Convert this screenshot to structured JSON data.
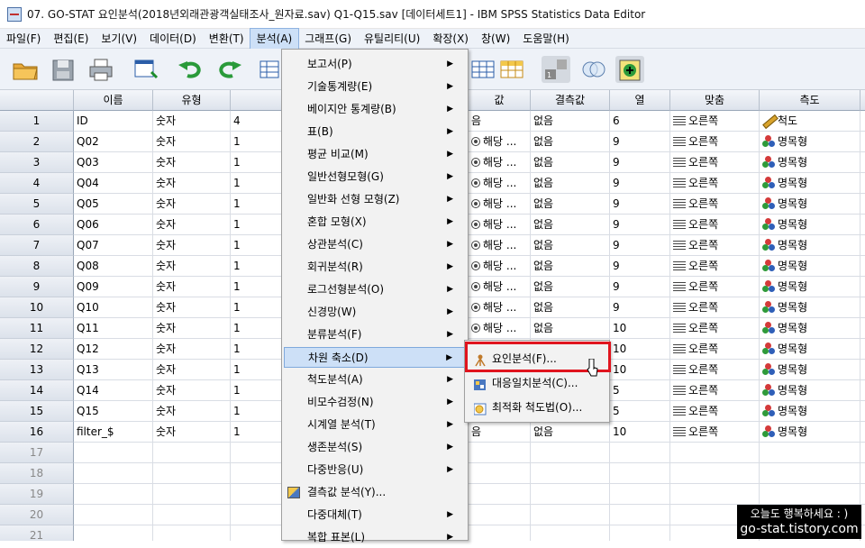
{
  "window": {
    "title": "07. GO-STAT 요인분석(2018년외래관광객실태조사_원자료.sav) Q1-Q15.sav [데이터세트1] - IBM SPSS Statistics Data Editor"
  },
  "menubar": [
    "파일(F)",
    "편집(E)",
    "보기(V)",
    "데이터(D)",
    "변환(T)",
    "분석(A)",
    "그래프(G)",
    "유틸리티(U)",
    "확장(X)",
    "창(W)",
    "도움말(H)"
  ],
  "grid": {
    "headers": [
      "이름",
      "유형",
      "너비",
      "값",
      "결측값",
      "열",
      "맞춤",
      "측도"
    ],
    "rows": [
      {
        "n": "1",
        "name": "ID",
        "type": "숫자",
        "width": "4",
        "value": "음",
        "missing": "없음",
        "col": "6",
        "align": "오른쪽",
        "measure": "척도"
      },
      {
        "n": "2",
        "name": "Q02",
        "type": "숫자",
        "width": "1",
        "value": "해당 ...",
        "missing": "없음",
        "col": "9",
        "align": "오른쪽",
        "measure": "명목형"
      },
      {
        "n": "3",
        "name": "Q03",
        "type": "숫자",
        "width": "1",
        "value": "해당 ...",
        "missing": "없음",
        "col": "9",
        "align": "오른쪽",
        "measure": "명목형"
      },
      {
        "n": "4",
        "name": "Q04",
        "type": "숫자",
        "width": "1",
        "value": "해당 ...",
        "missing": "없음",
        "col": "9",
        "align": "오른쪽",
        "measure": "명목형"
      },
      {
        "n": "5",
        "name": "Q05",
        "type": "숫자",
        "width": "1",
        "value": "해당 ...",
        "missing": "없음",
        "col": "9",
        "align": "오른쪽",
        "measure": "명목형"
      },
      {
        "n": "6",
        "name": "Q06",
        "type": "숫자",
        "width": "1",
        "value": "해당 ...",
        "missing": "없음",
        "col": "9",
        "align": "오른쪽",
        "measure": "명목형"
      },
      {
        "n": "7",
        "name": "Q07",
        "type": "숫자",
        "width": "1",
        "value": "해당 ...",
        "missing": "없음",
        "col": "9",
        "align": "오른쪽",
        "measure": "명목형"
      },
      {
        "n": "8",
        "name": "Q08",
        "type": "숫자",
        "width": "1",
        "value": "해당 ...",
        "missing": "없음",
        "col": "9",
        "align": "오른쪽",
        "measure": "명목형"
      },
      {
        "n": "9",
        "name": "Q09",
        "type": "숫자",
        "width": "1",
        "value": "해당 ...",
        "missing": "없음",
        "col": "9",
        "align": "오른쪽",
        "measure": "명목형"
      },
      {
        "n": "10",
        "name": "Q10",
        "type": "숫자",
        "width": "1",
        "value": "해당 ...",
        "missing": "없음",
        "col": "9",
        "align": "오른쪽",
        "measure": "명목형"
      },
      {
        "n": "11",
        "name": "Q11",
        "type": "숫자",
        "width": "1",
        "value": "해당 ...",
        "missing": "없음",
        "col": "10",
        "align": "오른쪽",
        "measure": "명목형"
      },
      {
        "n": "12",
        "name": "Q12",
        "type": "숫자",
        "width": "1",
        "value": "",
        "missing": "",
        "col": "10",
        "align": "오른쪽",
        "measure": "명목형"
      },
      {
        "n": "13",
        "name": "Q13",
        "type": "숫자",
        "width": "1",
        "value": "",
        "missing": "",
        "col": "10",
        "align": "오른쪽",
        "measure": "명목형"
      },
      {
        "n": "14",
        "name": "Q14",
        "type": "숫자",
        "width": "1",
        "value": "",
        "missing": "",
        "col": "5",
        "align": "오른쪽",
        "measure": "명목형"
      },
      {
        "n": "15",
        "name": "Q15",
        "type": "숫자",
        "width": "1",
        "value": "",
        "missing": "",
        "col": "5",
        "align": "오른쪽",
        "measure": "명목형"
      },
      {
        "n": "16",
        "name": "filter_$",
        "type": "숫자",
        "width": "1",
        "value": "음",
        "missing": "없음",
        "col": "10",
        "align": "오른쪽",
        "measure": "명목형"
      },
      {
        "n": "17"
      },
      {
        "n": "18"
      },
      {
        "n": "19"
      },
      {
        "n": "20"
      },
      {
        "n": "21"
      }
    ]
  },
  "analyze_menu": [
    "보고서(P)",
    "기술통계량(E)",
    "베이지안 통계량(B)",
    "표(B)",
    "평균 비교(M)",
    "일반선형모형(G)",
    "일반화 선형 모형(Z)",
    "혼합 모형(X)",
    "상관분석(C)",
    "회귀분석(R)",
    "로그선형분석(O)",
    "신경망(W)",
    "분류분석(F)",
    "차원 축소(D)",
    "척도분석(A)",
    "비모수검정(N)",
    "시계열 분석(T)",
    "생존분석(S)",
    "다중반응(U)",
    "결측값 분석(Y)...",
    "다중대체(T)",
    "복합 표본(L)"
  ],
  "submenu": [
    "요인분석(F)...",
    "대응일치분석(C)...",
    "최적화 척도법(O)..."
  ],
  "watermark": {
    "line1": "오늘도 행복하세요 : )",
    "line2": "go-stat.tistory.com"
  }
}
